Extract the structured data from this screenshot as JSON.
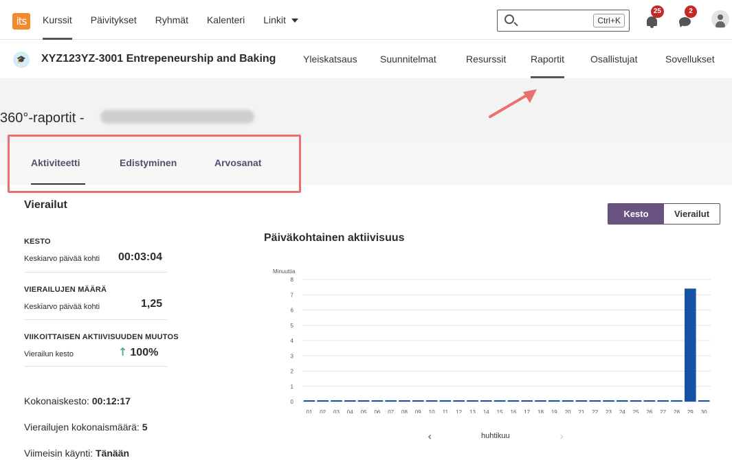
{
  "topnav": {
    "logo": "its",
    "items": [
      {
        "label": "Kurssit",
        "active": true
      },
      {
        "label": "Päivitykset"
      },
      {
        "label": "Ryhmät"
      },
      {
        "label": "Kalenteri"
      },
      {
        "label": "Linkit"
      }
    ],
    "search_shortcut": "Ctrl+K",
    "notifications_count": "25",
    "messages_count": "2"
  },
  "course": {
    "title": "XYZ123YZ-3001 Entrepeneurship and Baking",
    "tabs": [
      {
        "label": "Yleiskatsaus"
      },
      {
        "label": "Suunnitelmat"
      },
      {
        "label": "Resurssit"
      },
      {
        "label": "Raportit",
        "active": true
      },
      {
        "label": "Osallistujat"
      },
      {
        "label": "Sovellukset"
      }
    ]
  },
  "page": {
    "title": "360°-raportit -"
  },
  "report_tabs": [
    {
      "label": "Aktiviteetti",
      "active": true
    },
    {
      "label": "Edistyminen"
    },
    {
      "label": "Arvosanat"
    }
  ],
  "visits": {
    "title": "Vierailut",
    "duration": {
      "label": "KESTO",
      "sub": "Keskiarvo päivää kohti",
      "value": "00:03:04"
    },
    "count": {
      "label": "VIERAILUJEN MÄÄRÄ",
      "sub": "Keskiarvo päivää kohti",
      "value": "1,25"
    },
    "weekly": {
      "label": "VIIKOITTAISEN AKTIIVISUUDEN MUUTOS",
      "sub": "Vierailun kesto",
      "value": "100%"
    },
    "total_duration": {
      "label": "Kokonaiskesto:",
      "value": "00:12:17"
    },
    "total_count": {
      "label": "Vierailujen kokonaismäärä:",
      "value": "5"
    },
    "last_visit": {
      "label": "Viimeisin käynti:",
      "value": "Tänään"
    }
  },
  "toggle": {
    "on": "Kesto",
    "off": "Vierailut"
  },
  "pager": {
    "label": "huhtikuu"
  },
  "colors": {
    "accent": "#6a5380",
    "bar": "#1552a6",
    "highlight": "#ea6f6f",
    "trend_up": "#4caf7f"
  },
  "chart_data": {
    "type": "bar",
    "title": "Päiväkohtainen aktiivisuus",
    "ylabel": "Minuuttia",
    "xlabel": "",
    "ylim": [
      0,
      8
    ],
    "yticks": [
      0,
      1,
      2,
      3,
      4,
      5,
      6,
      7,
      8
    ],
    "grid": true,
    "categories": [
      "01",
      "02",
      "03",
      "04",
      "05",
      "06",
      "07",
      "08",
      "09",
      "10",
      "11",
      "12",
      "13",
      "14",
      "15",
      "16",
      "17",
      "18",
      "19",
      "20",
      "21",
      "22",
      "23",
      "24",
      "25",
      "26",
      "27",
      "28",
      "29",
      "30"
    ],
    "values": [
      0,
      0,
      0,
      0,
      0,
      0,
      0,
      0,
      0,
      0,
      0,
      0,
      0,
      0,
      0,
      0,
      0,
      0,
      0,
      0,
      0,
      0,
      0,
      0,
      0,
      0,
      0,
      0,
      7.4,
      0
    ]
  }
}
